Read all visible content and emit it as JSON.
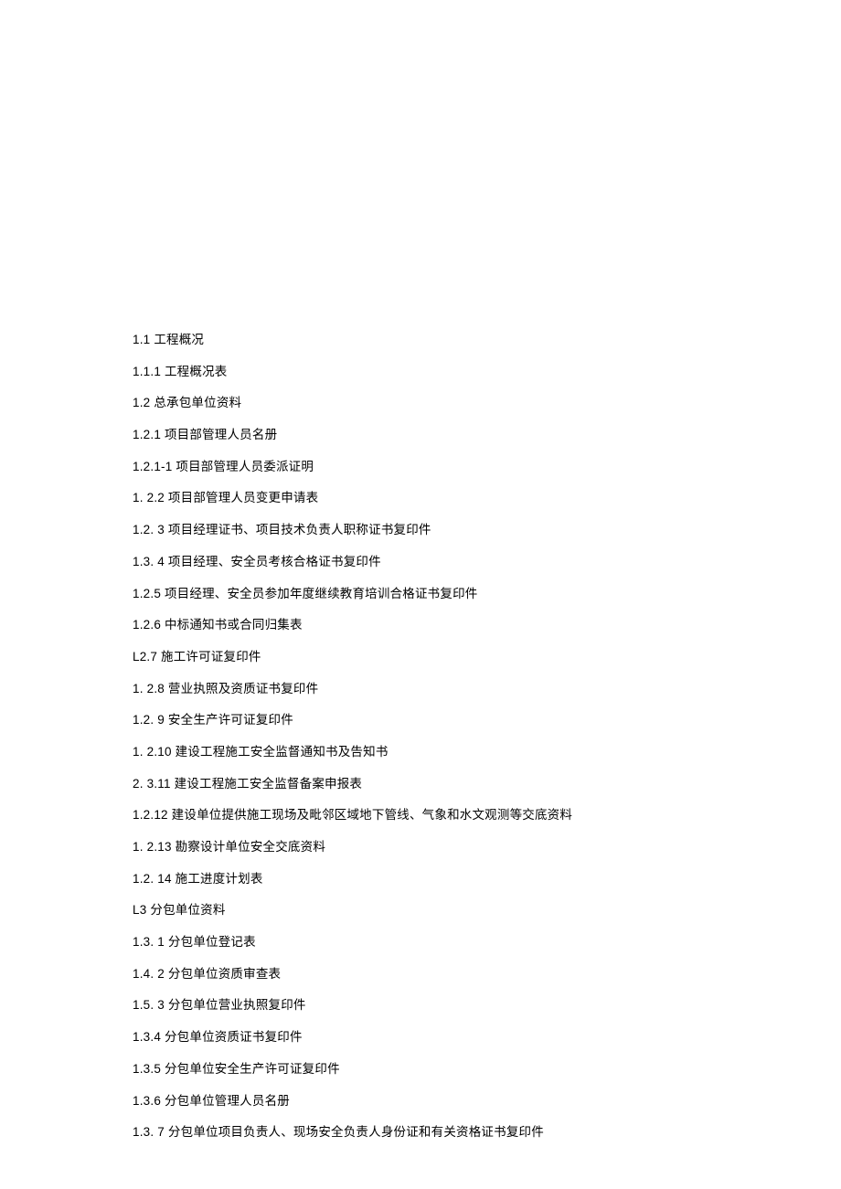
{
  "lines": [
    "1.1 工程概况",
    "1.1.1 工程概况表",
    "1.2 总承包单位资料",
    "1.2.1 项目部管理人员名册",
    "1.2.1-1 项目部管理人员委派证明",
    "1.    2.2 项目部管理人员变更申请表",
    "1.2.    3 项目经理证书、项目技术负责人职称证书复印件",
    "1.3.    4 项目经理、安全员考核合格证书复印件",
    "1.2.5 项目经理、安全员参加年度继续教育培训合格证书复印件",
    "1.2.6 中标通知书或合同归集表",
    "L2.7 施工许可证复印件",
    "1.    2.8 营业执照及资质证书复印件",
    "1.2.    9 安全生产许可证复印件",
    "1.    2.10 建设工程施工安全监督通知书及告知书",
    "2.    3.11 建设工程施工安全监督备案申报表",
    "1.2.12 建设单位提供施工现场及毗邻区域地下管线、气象和水文观测等交底资料",
    "1.    2.13 勘察设计单位安全交底资料",
    "1.2.    14 施工进度计划表",
    "L3 分包单位资料",
    "1.3.    1 分包单位登记表",
    "1.4.    2 分包单位资质审查表",
    "1.5.    3 分包单位营业执照复印件",
    "1.3.4 分包单位资质证书复印件",
    "1.3.5 分包单位安全生产许可证复印件",
    "1.3.6 分包单位管理人员名册",
    "1.3.    7 分包单位项目负责人、现场安全负责人身份证和有关资格证书复印件"
  ]
}
